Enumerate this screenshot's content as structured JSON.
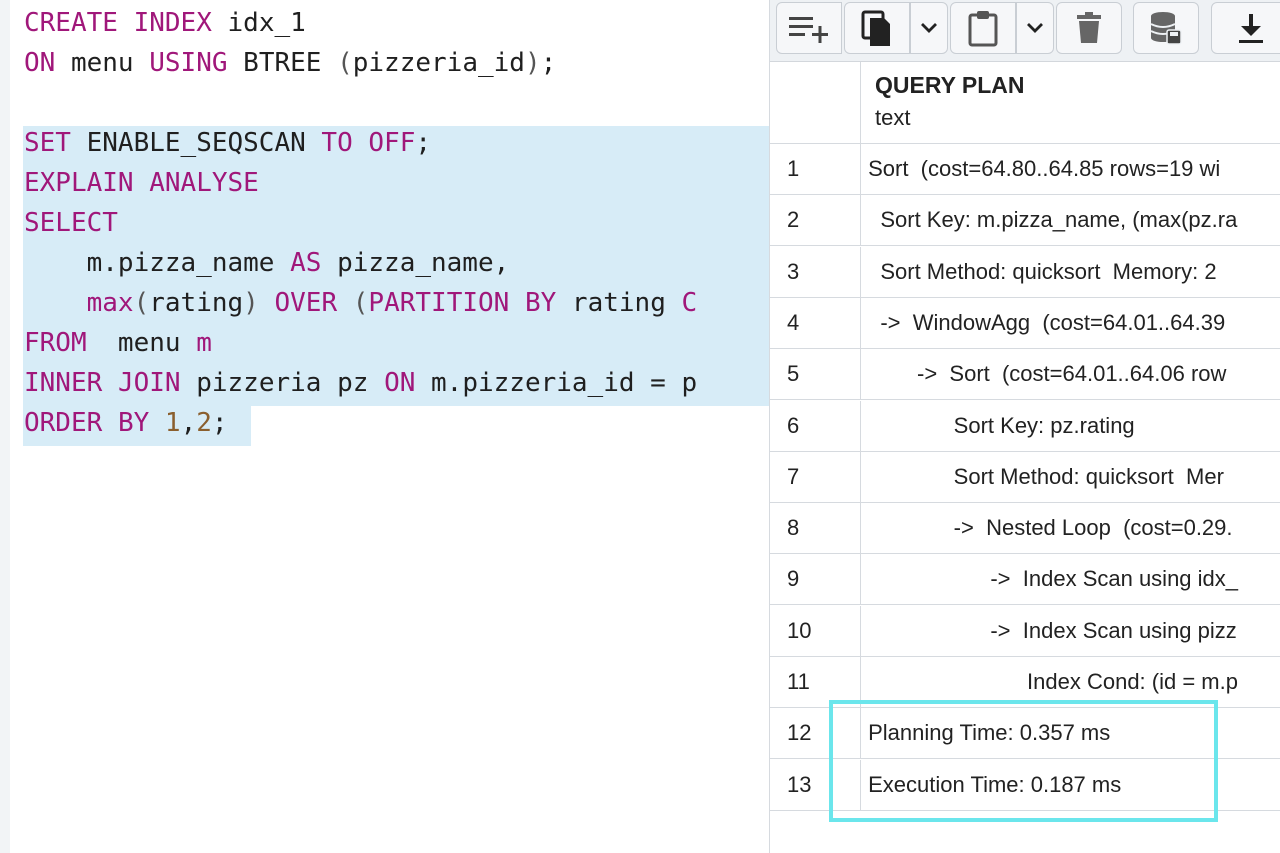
{
  "editor": {
    "lines": [
      {
        "tokens": [
          {
            "t": "CREATE",
            "c": "kw"
          },
          {
            "t": " "
          },
          {
            "t": "INDEX",
            "c": "kw"
          },
          {
            "t": " idx_1"
          }
        ]
      },
      {
        "tokens": [
          {
            "t": "ON",
            "c": "kw"
          },
          {
            "t": " menu "
          },
          {
            "t": "USING",
            "c": "kw"
          },
          {
            "t": " BTREE "
          },
          {
            "t": "(",
            "c": "dim"
          },
          {
            "t": "pizzeria_id"
          },
          {
            "t": ")",
            "c": "dim"
          },
          {
            "t": ";"
          }
        ]
      },
      {
        "tokens": []
      },
      {
        "tokens": [
          {
            "t": "SET",
            "c": "kw"
          },
          {
            "t": " ENABLE_SEQSCAN "
          },
          {
            "t": "TO",
            "c": "kw"
          },
          {
            "t": " "
          },
          {
            "t": "OFF",
            "c": "kw"
          },
          {
            "t": ";"
          }
        ]
      },
      {
        "tokens": [
          {
            "t": "EXPLAIN",
            "c": "kw"
          },
          {
            "t": " "
          },
          {
            "t": "ANALYSE",
            "c": "kw"
          }
        ]
      },
      {
        "tokens": [
          {
            "t": "SELECT",
            "c": "kw"
          }
        ]
      },
      {
        "tokens": [
          {
            "t": "    m.pizza_name "
          },
          {
            "t": "AS",
            "c": "kw"
          },
          {
            "t": " pizza_name,"
          }
        ]
      },
      {
        "tokens": [
          {
            "t": "    "
          },
          {
            "t": "max",
            "c": "kw"
          },
          {
            "t": "(",
            "c": "dim"
          },
          {
            "t": "rating"
          },
          {
            "t": ")",
            "c": "dim"
          },
          {
            "t": " "
          },
          {
            "t": "OVER",
            "c": "kw"
          },
          {
            "t": " "
          },
          {
            "t": "(",
            "c": "dim"
          },
          {
            "t": "PARTITION",
            "c": "kw"
          },
          {
            "t": " "
          },
          {
            "t": "BY",
            "c": "kw"
          },
          {
            "t": " rating "
          },
          {
            "t": "C",
            "c": "kw"
          }
        ]
      },
      {
        "tokens": [
          {
            "t": "FROM",
            "c": "kw"
          },
          {
            "t": "  menu "
          },
          {
            "t": "m",
            "c": "kw"
          }
        ]
      },
      {
        "tokens": [
          {
            "t": "INNER",
            "c": "kw"
          },
          {
            "t": " "
          },
          {
            "t": "JOIN",
            "c": "kw"
          },
          {
            "t": " pizzeria pz "
          },
          {
            "t": "ON",
            "c": "kw"
          },
          {
            "t": " m.pizzeria_id = p"
          }
        ]
      },
      {
        "tokens": [
          {
            "t": "ORDER",
            "c": "kw"
          },
          {
            "t": " "
          },
          {
            "t": "BY",
            "c": "kw"
          },
          {
            "t": " "
          },
          {
            "t": "1",
            "c": "num"
          },
          {
            "t": ","
          },
          {
            "t": "2",
            "c": "num"
          },
          {
            "t": ";"
          }
        ]
      }
    ]
  },
  "toolbar": {
    "buttons": [
      {
        "name": "add-row-icon"
      },
      {
        "name": "copy-icon"
      },
      {
        "name": "copy-dropdown-chevron-icon"
      },
      {
        "name": "paste-icon"
      },
      {
        "name": "paste-dropdown-chevron-icon"
      },
      {
        "name": "delete-icon"
      },
      {
        "name": "save-data-icon"
      },
      {
        "name": "download-icon"
      }
    ]
  },
  "grid": {
    "column_title": "QUERY PLAN",
    "column_type": "text",
    "rows": [
      {
        "n": "1",
        "text": "Sort  (cost=64.80..64.85 rows=19 wi"
      },
      {
        "n": "2",
        "text": "  Sort Key: m.pizza_name, (max(pz.ra"
      },
      {
        "n": "3",
        "text": "  Sort Method: quicksort  Memory: 2"
      },
      {
        "n": "4",
        "text": "  ->  WindowAgg  (cost=64.01..64.39"
      },
      {
        "n": "5",
        "text": "        ->  Sort  (cost=64.01..64.06 row"
      },
      {
        "n": "6",
        "text": "              Sort Key: pz.rating"
      },
      {
        "n": "7",
        "text": "              Sort Method: quicksort  Mer"
      },
      {
        "n": "8",
        "text": "              ->  Nested Loop  (cost=0.29."
      },
      {
        "n": "9",
        "text": "                    ->  Index Scan using idx_"
      },
      {
        "n": "10",
        "text": "                    ->  Index Scan using pizz"
      },
      {
        "n": "11",
        "text": "                          Index Cond: (id = m.p"
      },
      {
        "n": "12",
        "text": "Planning Time: 0.357 ms"
      },
      {
        "n": "13",
        "text": "Execution Time: 0.187 ms"
      }
    ]
  },
  "colors": {
    "keyword": "#a0177a",
    "number": "#8a5f2e",
    "selection": "#d7ecf7",
    "highlight_box": "#6be6ec"
  }
}
